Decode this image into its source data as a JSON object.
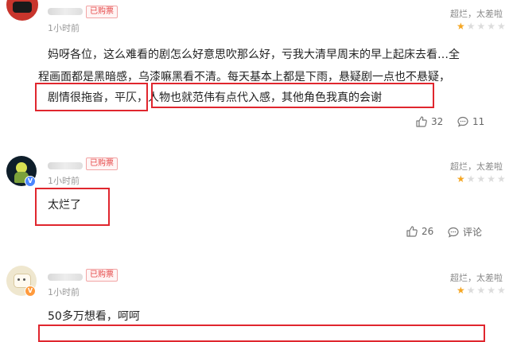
{
  "comments": [
    {
      "badge": "已购票",
      "time": "1小时前",
      "rating_label": "超烂，太差啦",
      "rating_stars": 0.5,
      "text_lines": [
        "妈呀各位，这么难看的剧怎么好意思吹那么好，亏我大清早周末的早上起床去看…全",
        "程画面都是黑暗感，乌漆嘛黑看不清。每天基本上都是下雨，悬疑剧一点也不悬疑，",
        "剧情很拖沓，平仄，人物也就范伟有点代入感，其他角色我真的会谢"
      ],
      "likes": "32",
      "replies": "11"
    },
    {
      "badge": "已购票",
      "time": "1小时前",
      "rating_label": "超烂，太差啦",
      "rating_stars": 0.5,
      "text_lines": [
        "太烂了"
      ],
      "likes": "26",
      "replies": "评论"
    },
    {
      "badge": "已购票",
      "time": "1小时前",
      "rating_label": "超烂，太差啦",
      "rating_stars": 1,
      "text_lines": [
        "50多万想看，呵呵"
      ]
    }
  ],
  "colors": {
    "highlight_box": "#e0262e",
    "badge_text": "#e54646",
    "star": "#f5a623"
  },
  "icons": {
    "like": "thumbs-up-icon",
    "reply": "comment-bubble-icon"
  }
}
